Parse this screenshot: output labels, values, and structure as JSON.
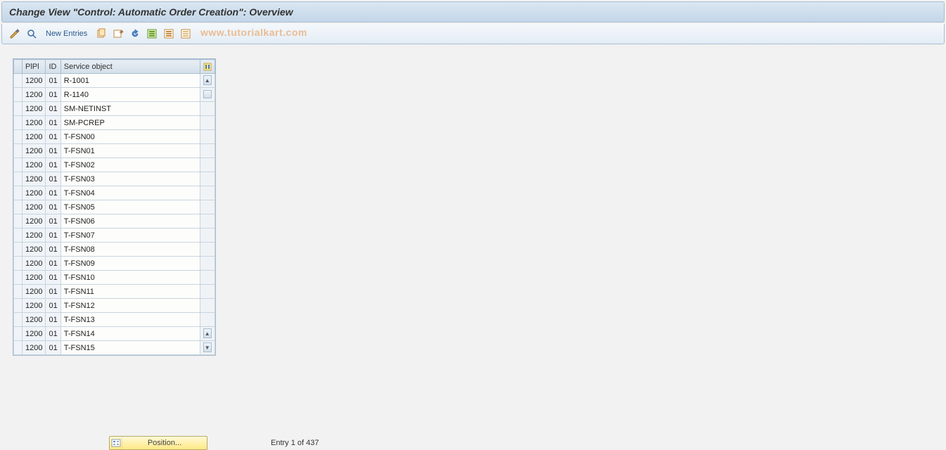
{
  "header": {
    "title": "Change View \"Control: Automatic Order Creation\": Overview"
  },
  "toolbar": {
    "new_entries_label": "New Entries"
  },
  "watermark": "www.tutorialkart.com",
  "table": {
    "columns": {
      "pipi": "PlPl",
      "id": "ID",
      "service_object": "Service object"
    },
    "rows": [
      {
        "pipi": "1200",
        "id": "01",
        "so": "R-1001"
      },
      {
        "pipi": "1200",
        "id": "01",
        "so": "R-1140"
      },
      {
        "pipi": "1200",
        "id": "01",
        "so": "SM-NETINST"
      },
      {
        "pipi": "1200",
        "id": "01",
        "so": "SM-PCREP"
      },
      {
        "pipi": "1200",
        "id": "01",
        "so": "T-FSN00"
      },
      {
        "pipi": "1200",
        "id": "01",
        "so": "T-FSN01"
      },
      {
        "pipi": "1200",
        "id": "01",
        "so": "T-FSN02"
      },
      {
        "pipi": "1200",
        "id": "01",
        "so": "T-FSN03"
      },
      {
        "pipi": "1200",
        "id": "01",
        "so": "T-FSN04"
      },
      {
        "pipi": "1200",
        "id": "01",
        "so": "T-FSN05"
      },
      {
        "pipi": "1200",
        "id": "01",
        "so": "T-FSN06"
      },
      {
        "pipi": "1200",
        "id": "01",
        "so": "T-FSN07"
      },
      {
        "pipi": "1200",
        "id": "01",
        "so": "T-FSN08"
      },
      {
        "pipi": "1200",
        "id": "01",
        "so": "T-FSN09"
      },
      {
        "pipi": "1200",
        "id": "01",
        "so": "T-FSN10"
      },
      {
        "pipi": "1200",
        "id": "01",
        "so": "T-FSN11"
      },
      {
        "pipi": "1200",
        "id": "01",
        "so": "T-FSN12"
      },
      {
        "pipi": "1200",
        "id": "01",
        "so": "T-FSN13"
      },
      {
        "pipi": "1200",
        "id": "01",
        "so": "T-FSN14"
      },
      {
        "pipi": "1200",
        "id": "01",
        "so": "T-FSN15"
      }
    ]
  },
  "footer": {
    "position_label": "Position...",
    "entry_status": "Entry 1 of 437"
  }
}
